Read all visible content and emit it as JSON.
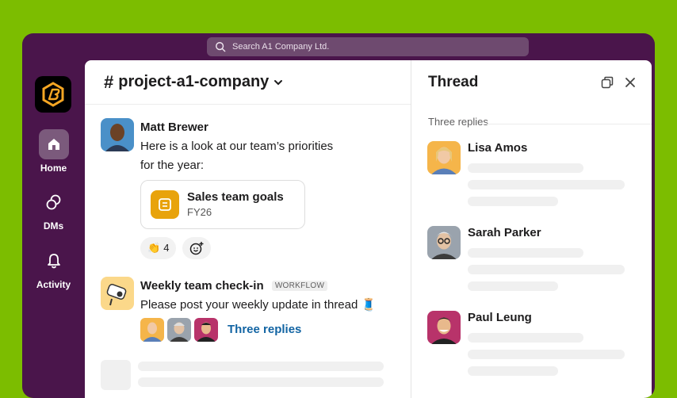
{
  "search": {
    "placeholder": "Search A1 Company Ltd."
  },
  "rail": {
    "items": [
      {
        "label": "Home",
        "icon": "home-icon",
        "active": true
      },
      {
        "label": "DMs",
        "icon": "dms-icon",
        "active": false
      },
      {
        "label": "Activity",
        "icon": "bell-icon",
        "active": false
      }
    ]
  },
  "channel": {
    "name": "project-a1-company",
    "messages": [
      {
        "author": "Matt Brewer",
        "text_line1": "Here is a look at our team’s priorities",
        "text_line2": "for the year:",
        "file": {
          "title": "Sales team goals",
          "subtitle": "FY26"
        },
        "reaction": {
          "emoji": "👏",
          "count": "4"
        }
      },
      {
        "author": "Weekly team check-in",
        "tag": "WORKFLOW",
        "text": "Please post your weekly update in thread 🧵",
        "replies_label": "Three replies"
      }
    ]
  },
  "thread": {
    "title": "Thread",
    "replies_count_label": "Three replies",
    "replies": [
      {
        "name": "Lisa Amos"
      },
      {
        "name": "Sarah Parker"
      },
      {
        "name": "Paul Leung"
      }
    ]
  },
  "colors": {
    "background": "#7cbd00",
    "sidebar": "#4a154b",
    "link": "#1264a3",
    "file_icon": "#e8a30c"
  }
}
